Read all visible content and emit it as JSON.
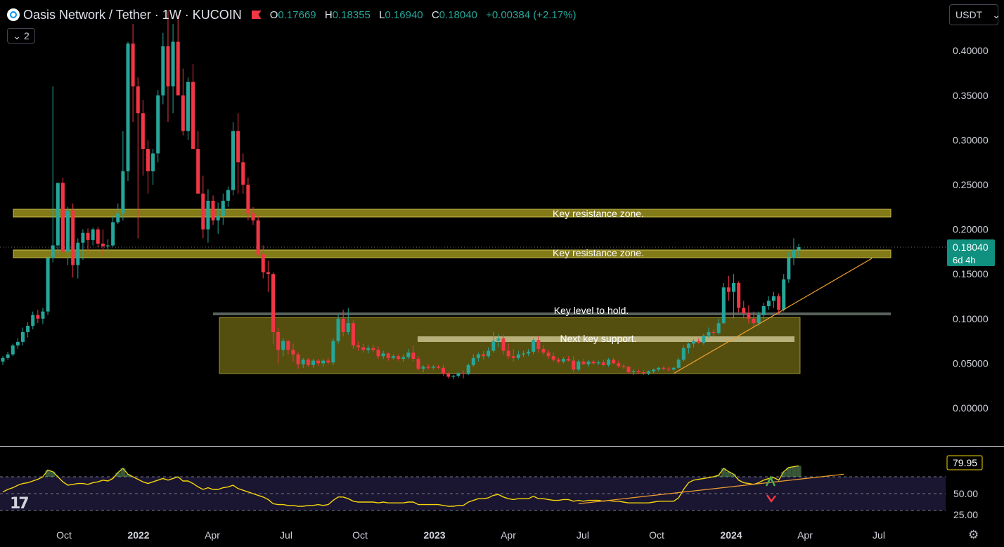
{
  "header": {
    "symbol_title": "Oasis Network / Tether · 1W · KUCOIN",
    "open_label": "O",
    "open_value": "0.17669",
    "high_label": "H",
    "high_value": "0.18355",
    "low_label": "L",
    "low_value": "0.16940",
    "close_label": "C",
    "close_value": "0.18040",
    "change": "+0.00384 (+2.17%)"
  },
  "indicator_toggle": {
    "count": "2"
  },
  "currency_select": {
    "value": "USDT"
  },
  "price_badge": {
    "price": "0.18040",
    "countdown": "6d 4h"
  },
  "rsi_badge": {
    "value": "79.95"
  },
  "colors": {
    "up": "#26a69a",
    "down": "#f23645",
    "zone": "#9a8f1c",
    "trendline": "#f0a030",
    "rsi_line": "#f5d60a",
    "price_badge_bg": "#10907f",
    "gray_level": "#59625c"
  },
  "chart_data": [
    {
      "type": "candlestick",
      "title": "Oasis Network / Tether · 1W · KUCOIN",
      "y_ticks": [
        "0.40000",
        "0.35000",
        "0.30000",
        "0.25000",
        "0.20000",
        "0.15000",
        "0.10000",
        "0.05000",
        "0.00000"
      ],
      "ylim": [
        0,
        0.4
      ],
      "x_ticks": [
        "Oct",
        "2022",
        "Apr",
        "Jul",
        "Oct",
        "2023",
        "Apr",
        "Jul",
        "Oct",
        "2024",
        "Apr",
        "Jul"
      ],
      "x_tick_bold": [
        "2022",
        "2023",
        "2024"
      ],
      "x": {
        "start": "2021-06-07",
        "end": "2024-03-11",
        "interval": "1W"
      },
      "candles": [
        [
          0.052,
          0.058,
          0.048,
          0.056
        ],
        [
          0.056,
          0.063,
          0.054,
          0.06
        ],
        [
          0.06,
          0.072,
          0.058,
          0.07
        ],
        [
          0.07,
          0.078,
          0.066,
          0.074
        ],
        [
          0.074,
          0.09,
          0.07,
          0.085
        ],
        [
          0.085,
          0.096,
          0.079,
          0.092
        ],
        [
          0.092,
          0.108,
          0.088,
          0.104
        ],
        [
          0.104,
          0.11,
          0.095,
          0.1
        ],
        [
          0.1,
          0.112,
          0.094,
          0.108
        ],
        [
          0.108,
          0.17,
          0.104,
          0.168
        ],
        [
          0.168,
          0.36,
          0.163,
          0.182
        ],
        [
          0.182,
          0.25,
          0.172,
          0.252
        ],
        [
          0.252,
          0.258,
          0.174,
          0.175
        ],
        [
          0.175,
          0.225,
          0.16,
          0.221
        ],
        [
          0.221,
          0.229,
          0.146,
          0.16
        ],
        [
          0.16,
          0.19,
          0.145,
          0.185
        ],
        [
          0.185,
          0.2,
          0.166,
          0.196
        ],
        [
          0.196,
          0.201,
          0.176,
          0.188
        ],
        [
          0.188,
          0.202,
          0.182,
          0.2
        ],
        [
          0.2,
          0.203,
          0.18,
          0.184
        ],
        [
          0.184,
          0.2,
          0.172,
          0.181
        ],
        [
          0.181,
          0.189,
          0.176,
          0.182
        ],
        [
          0.182,
          0.215,
          0.18,
          0.208
        ],
        [
          0.208,
          0.229,
          0.206,
          0.218
        ],
        [
          0.218,
          0.31,
          0.21,
          0.265
        ],
        [
          0.265,
          0.41,
          0.254,
          0.408
        ],
        [
          0.408,
          0.43,
          0.32,
          0.36
        ],
        [
          0.36,
          0.37,
          0.19,
          0.33
        ],
        [
          0.33,
          0.345,
          0.26,
          0.29
        ],
        [
          0.29,
          0.3,
          0.24,
          0.265
        ],
        [
          0.265,
          0.29,
          0.25,
          0.285
        ],
        [
          0.285,
          0.356,
          0.275,
          0.35
        ],
        [
          0.35,
          0.42,
          0.34,
          0.405
        ],
        [
          0.405,
          0.445,
          0.32,
          0.36
        ],
        [
          0.36,
          0.43,
          0.33,
          0.41
        ],
        [
          0.41,
          0.44,
          0.35,
          0.35
        ],
        [
          0.35,
          0.38,
          0.305,
          0.31
        ],
        [
          0.31,
          0.37,
          0.3,
          0.365
        ],
        [
          0.365,
          0.385,
          0.29,
          0.29
        ],
        [
          0.29,
          0.31,
          0.24,
          0.24
        ],
        [
          0.24,
          0.26,
          0.19,
          0.2
        ],
        [
          0.2,
          0.245,
          0.185,
          0.232
        ],
        [
          0.232,
          0.238,
          0.205,
          0.21
        ],
        [
          0.21,
          0.23,
          0.195,
          0.215
        ],
        [
          0.215,
          0.24,
          0.205,
          0.232
        ],
        [
          0.232,
          0.248,
          0.225,
          0.244
        ],
        [
          0.244,
          0.32,
          0.238,
          0.31
        ],
        [
          0.31,
          0.33,
          0.24,
          0.275
        ],
        [
          0.275,
          0.285,
          0.24,
          0.25
        ],
        [
          0.25,
          0.258,
          0.21,
          0.218
        ],
        [
          0.218,
          0.225,
          0.205,
          0.21
        ],
        [
          0.21,
          0.215,
          0.17,
          0.172
        ],
        [
          0.172,
          0.182,
          0.145,
          0.152
        ],
        [
          0.152,
          0.165,
          0.13,
          0.15
        ],
        [
          0.15,
          0.152,
          0.072,
          0.085
        ],
        [
          0.085,
          0.09,
          0.05,
          0.065
        ],
        [
          0.065,
          0.078,
          0.058,
          0.075
        ],
        [
          0.075,
          0.076,
          0.06,
          0.065
        ],
        [
          0.065,
          0.072,
          0.052,
          0.06
        ],
        [
          0.06,
          0.062,
          0.044,
          0.049
        ],
        [
          0.049,
          0.056,
          0.045,
          0.054
        ],
        [
          0.054,
          0.056,
          0.046,
          0.048
        ],
        [
          0.048,
          0.055,
          0.045,
          0.053
        ],
        [
          0.053,
          0.055,
          0.047,
          0.05
        ],
        [
          0.05,
          0.055,
          0.046,
          0.053
        ],
        [
          0.053,
          0.056,
          0.049,
          0.051
        ],
        [
          0.051,
          0.078,
          0.048,
          0.075
        ],
        [
          0.075,
          0.105,
          0.072,
          0.1
        ],
        [
          0.1,
          0.11,
          0.08,
          0.085
        ],
        [
          0.085,
          0.112,
          0.082,
          0.095
        ],
        [
          0.095,
          0.098,
          0.066,
          0.07
        ],
        [
          0.07,
          0.074,
          0.064,
          0.068
        ],
        [
          0.068,
          0.072,
          0.062,
          0.065
        ],
        [
          0.065,
          0.07,
          0.061,
          0.067
        ],
        [
          0.067,
          0.071,
          0.063,
          0.065
        ],
        [
          0.065,
          0.069,
          0.055,
          0.058
        ],
        [
          0.058,
          0.064,
          0.055,
          0.061
        ],
        [
          0.061,
          0.062,
          0.053,
          0.056
        ],
        [
          0.056,
          0.06,
          0.054,
          0.058
        ],
        [
          0.058,
          0.06,
          0.053,
          0.055
        ],
        [
          0.055,
          0.06,
          0.052,
          0.057
        ],
        [
          0.057,
          0.066,
          0.055,
          0.062
        ],
        [
          0.062,
          0.07,
          0.052,
          0.055
        ],
        [
          0.055,
          0.058,
          0.042,
          0.044
        ],
        [
          0.044,
          0.048,
          0.04,
          0.046
        ],
        [
          0.046,
          0.049,
          0.043,
          0.045
        ],
        [
          0.045,
          0.048,
          0.043,
          0.046
        ],
        [
          0.046,
          0.048,
          0.044,
          0.045
        ],
        [
          0.045,
          0.048,
          0.036,
          0.038
        ],
        [
          0.038,
          0.04,
          0.033,
          0.035
        ],
        [
          0.035,
          0.037,
          0.032,
          0.036
        ],
        [
          0.036,
          0.04,
          0.034,
          0.039
        ],
        [
          0.039,
          0.042,
          0.033,
          0.038
        ],
        [
          0.038,
          0.05,
          0.037,
          0.048
        ],
        [
          0.048,
          0.06,
          0.046,
          0.056
        ],
        [
          0.056,
          0.062,
          0.052,
          0.06
        ],
        [
          0.06,
          0.064,
          0.054,
          0.058
        ],
        [
          0.058,
          0.068,
          0.056,
          0.064
        ],
        [
          0.064,
          0.085,
          0.062,
          0.075
        ],
        [
          0.075,
          0.083,
          0.068,
          0.078
        ],
        [
          0.078,
          0.082,
          0.06,
          0.064
        ],
        [
          0.064,
          0.072,
          0.055,
          0.058
        ],
        [
          0.058,
          0.066,
          0.052,
          0.056
        ],
        [
          0.056,
          0.064,
          0.054,
          0.06
        ],
        [
          0.06,
          0.064,
          0.057,
          0.061
        ],
        [
          0.061,
          0.066,
          0.058,
          0.063
        ],
        [
          0.063,
          0.078,
          0.06,
          0.076
        ],
        [
          0.076,
          0.081,
          0.062,
          0.066
        ],
        [
          0.066,
          0.07,
          0.06,
          0.062
        ],
        [
          0.062,
          0.065,
          0.055,
          0.058
        ],
        [
          0.058,
          0.062,
          0.052,
          0.054
        ],
        [
          0.054,
          0.056,
          0.05,
          0.052
        ],
        [
          0.052,
          0.057,
          0.05,
          0.055
        ],
        [
          0.055,
          0.058,
          0.052,
          0.053
        ],
        [
          0.053,
          0.058,
          0.04,
          0.043
        ],
        [
          0.043,
          0.054,
          0.041,
          0.052
        ],
        [
          0.052,
          0.055,
          0.048,
          0.049
        ],
        [
          0.049,
          0.054,
          0.046,
          0.052
        ],
        [
          0.052,
          0.054,
          0.048,
          0.05
        ],
        [
          0.05,
          0.053,
          0.048,
          0.051
        ],
        [
          0.051,
          0.054,
          0.047,
          0.048
        ],
        [
          0.048,
          0.056,
          0.046,
          0.054
        ],
        [
          0.054,
          0.056,
          0.049,
          0.05
        ],
        [
          0.05,
          0.053,
          0.045,
          0.047
        ],
        [
          0.047,
          0.049,
          0.044,
          0.046
        ],
        [
          0.046,
          0.047,
          0.038,
          0.04
        ],
        [
          0.04,
          0.043,
          0.037,
          0.041
        ],
        [
          0.041,
          0.043,
          0.038,
          0.04
        ],
        [
          0.04,
          0.042,
          0.037,
          0.039
        ],
        [
          0.039,
          0.042,
          0.037,
          0.041
        ],
        [
          0.041,
          0.044,
          0.039,
          0.043
        ],
        [
          0.043,
          0.046,
          0.041,
          0.045
        ],
        [
          0.045,
          0.047,
          0.042,
          0.044
        ],
        [
          0.044,
          0.046,
          0.041,
          0.043
        ],
        [
          0.043,
          0.046,
          0.041,
          0.045
        ],
        [
          0.045,
          0.056,
          0.044,
          0.054
        ],
        [
          0.054,
          0.07,
          0.052,
          0.067
        ],
        [
          0.067,
          0.073,
          0.061,
          0.072
        ],
        [
          0.072,
          0.077,
          0.068,
          0.075
        ],
        [
          0.075,
          0.078,
          0.072,
          0.073
        ],
        [
          0.073,
          0.083,
          0.071,
          0.081
        ],
        [
          0.081,
          0.09,
          0.078,
          0.085
        ],
        [
          0.085,
          0.088,
          0.08,
          0.084
        ],
        [
          0.084,
          0.1,
          0.082,
          0.095
        ],
        [
          0.095,
          0.14,
          0.094,
          0.135
        ],
        [
          0.135,
          0.148,
          0.12,
          0.13
        ],
        [
          0.13,
          0.15,
          0.1,
          0.14
        ],
        [
          0.14,
          0.142,
          0.107,
          0.112
        ],
        [
          0.112,
          0.12,
          0.1,
          0.106
        ],
        [
          0.106,
          0.115,
          0.095,
          0.1
        ],
        [
          0.1,
          0.108,
          0.091,
          0.095
        ],
        [
          0.095,
          0.108,
          0.092,
          0.104
        ],
        [
          0.104,
          0.118,
          0.1,
          0.114
        ],
        [
          0.114,
          0.125,
          0.11,
          0.12
        ],
        [
          0.12,
          0.13,
          0.112,
          0.125
        ],
        [
          0.125,
          0.128,
          0.105,
          0.11
        ],
        [
          0.11,
          0.15,
          0.108,
          0.144
        ],
        [
          0.144,
          0.175,
          0.14,
          0.168
        ],
        [
          0.168,
          0.19,
          0.16,
          0.177
        ],
        [
          0.177,
          0.184,
          0.169,
          0.18
        ]
      ],
      "annotations": [
        "Key resistance zone.",
        "Key resistance zone.",
        "Key level to hold.",
        "Next key support."
      ],
      "last_price": 0.1804,
      "grid": false
    },
    {
      "type": "line",
      "title": "",
      "y_ticks": [
        "50.00",
        "25.00"
      ],
      "levels": [
        70,
        50,
        30
      ],
      "ylim": [
        20,
        95
      ],
      "x": {
        "start": "2021-06-07",
        "end": "2024-03-11",
        "interval": "1W"
      },
      "values": [
        52,
        55,
        57,
        60,
        62,
        63,
        65,
        67,
        70,
        78,
        76,
        70,
        64,
        60,
        61,
        62,
        62,
        61,
        63,
        64,
        66,
        65,
        68,
        75,
        80,
        73,
        70,
        67,
        64,
        62,
        64,
        66,
        68,
        66,
        68,
        70,
        65,
        65,
        62,
        58,
        55,
        57,
        55,
        55,
        57,
        58,
        60,
        56,
        54,
        52,
        50,
        48,
        46,
        43,
        38,
        37,
        37,
        36,
        36,
        35,
        35,
        36,
        36,
        37,
        36,
        37,
        42,
        46,
        46,
        44,
        41,
        40,
        40,
        40,
        40,
        39,
        40,
        39,
        39,
        39,
        39,
        40,
        40,
        37,
        37,
        37,
        37,
        37,
        36,
        35,
        35,
        36,
        36,
        40,
        42,
        44,
        44,
        45,
        48,
        49,
        46,
        44,
        43,
        44,
        44,
        44,
        47,
        44,
        44,
        43,
        42,
        42,
        43,
        43,
        41,
        42,
        41,
        42,
        42,
        42,
        41,
        42,
        41,
        41,
        40,
        39,
        39,
        39,
        39,
        39,
        40,
        41,
        41,
        41,
        41,
        45,
        55,
        63,
        66,
        67,
        68,
        69,
        70,
        72,
        80,
        76,
        73,
        66,
        63,
        62,
        61,
        63,
        66,
        68,
        69,
        66,
        76,
        81,
        82,
        83
      ],
      "trendline": {
        "from": [
          "2023-08-21",
          38
        ],
        "to": [
          "2024-08-26",
          73
        ]
      },
      "last_value": 79.95
    }
  ]
}
